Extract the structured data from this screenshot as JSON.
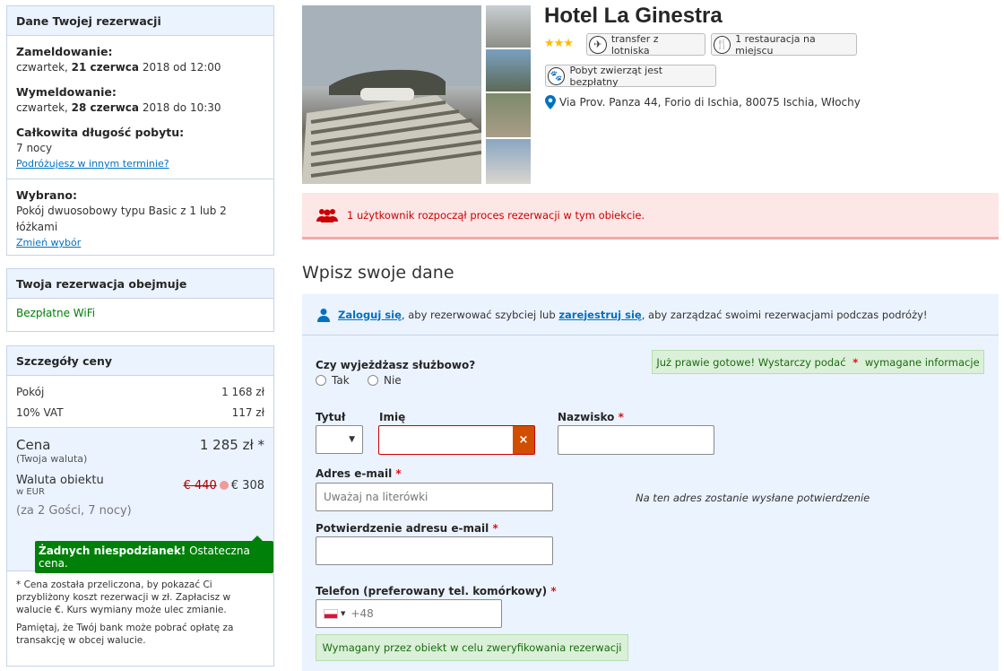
{
  "sidebar": {
    "booking": {
      "title": "Dane Twojej rezerwacji",
      "checkin_label": "Zameldowanie:",
      "checkin_day": "czwartek, ",
      "checkin_date": "21 czerwca",
      "checkin_rest": " 2018 od 12:00",
      "checkout_label": "Wymeldowanie:",
      "checkout_day": "czwartek, ",
      "checkout_date": "28 czerwca",
      "checkout_rest": " 2018 do 10:30",
      "length_label": "Całkowita długość pobytu:",
      "length_value": "7 nocy",
      "change_dates_link": "Podróżujesz w innym terminie?",
      "selected_label": "Wybrano:",
      "selected_value": "Pokój dwuosobowy typu Basic z 1 lub 2 łóżkami",
      "change_selection_link": "Zmień wybór"
    },
    "includes": {
      "title": "Twoja rezerwacja obejmuje",
      "item": "Bezpłatne WiFi"
    },
    "price": {
      "title": "Szczegóły ceny",
      "room_label": "Pokój",
      "room_value": "1 168 zł",
      "vat_label": "10% VAT",
      "vat_value": "117 zł",
      "total_label": "Cena",
      "total_sub": "(Twoja waluta)",
      "total_value": "1 285 zł *",
      "hotel_currency_label": "Waluta obiektu",
      "hotel_currency_sub": "w EUR",
      "old_price": "€ 440",
      "new_price": "€ 308",
      "guests_nights": "(za 2 Gości, 7 nocy)",
      "badge_bold": "Żadnych niespodzianek!",
      "badge_rest": " Ostateczna cena.",
      "note1": "* Cena została przeliczona, by pokazać Ci przybliżony koszt rezerwacji w zł. Zapłacisz w walucie €. Kurs wymiany może ulec zmianie.",
      "note2": "Pamiętaj, że Twój bank może pobrać opłatę za transakcję w obcej walucie."
    }
  },
  "hotel": {
    "name": "Hotel La Ginestra",
    "stars": "★★★",
    "facility1": "transfer z lotniska",
    "facility2": "1 restauracja na miejscu",
    "facility3": "Pobyt zwierząt jest bezpłatny",
    "address": "Via Prov. Panza 44, Forio di Ischia, 80075 Ischia, Włochy"
  },
  "alert": {
    "text": "1 użytkownik rozpoczął proces rezerwacji w tym obiekcie."
  },
  "form": {
    "heading": "Wpisz swoje dane",
    "login_link": "Zaloguj się",
    "login_mid": ", aby rezerwować szybciej lub ",
    "register_link": "zarejestruj się",
    "login_end": ", aby zarządzać swoimi rezerwacjami podczas podróży!",
    "business_question": "Czy wyjeżdżasz służbowo?",
    "opt_yes": "Tak",
    "opt_no": "Nie",
    "almost_ready_a": "Już prawie gotowe! Wystarczy podać ",
    "almost_ready_star": "*",
    "almost_ready_b": " wymagane informacje",
    "title_label": "Tytuł",
    "first_name_label": "Imię",
    "last_name_label": "Nazwisko",
    "required_star": "*",
    "email_label": "Adres e-mail",
    "email_placeholder": "Uważaj na literówki",
    "email_note": "Na ten adres zostanie wysłane potwierdzenie",
    "email_confirm_label": "Potwierdzenie adresu e-mail",
    "phone_label": "Telefon (preferowany tel. komórkowy)",
    "phone_prefix": "+48",
    "phone_note": "Wymagany przez obiekt w celu zweryfikowania rezerwacji"
  },
  "colors": {
    "accent": "#0071c2",
    "alert": "#cc0000",
    "success": "#008009"
  }
}
